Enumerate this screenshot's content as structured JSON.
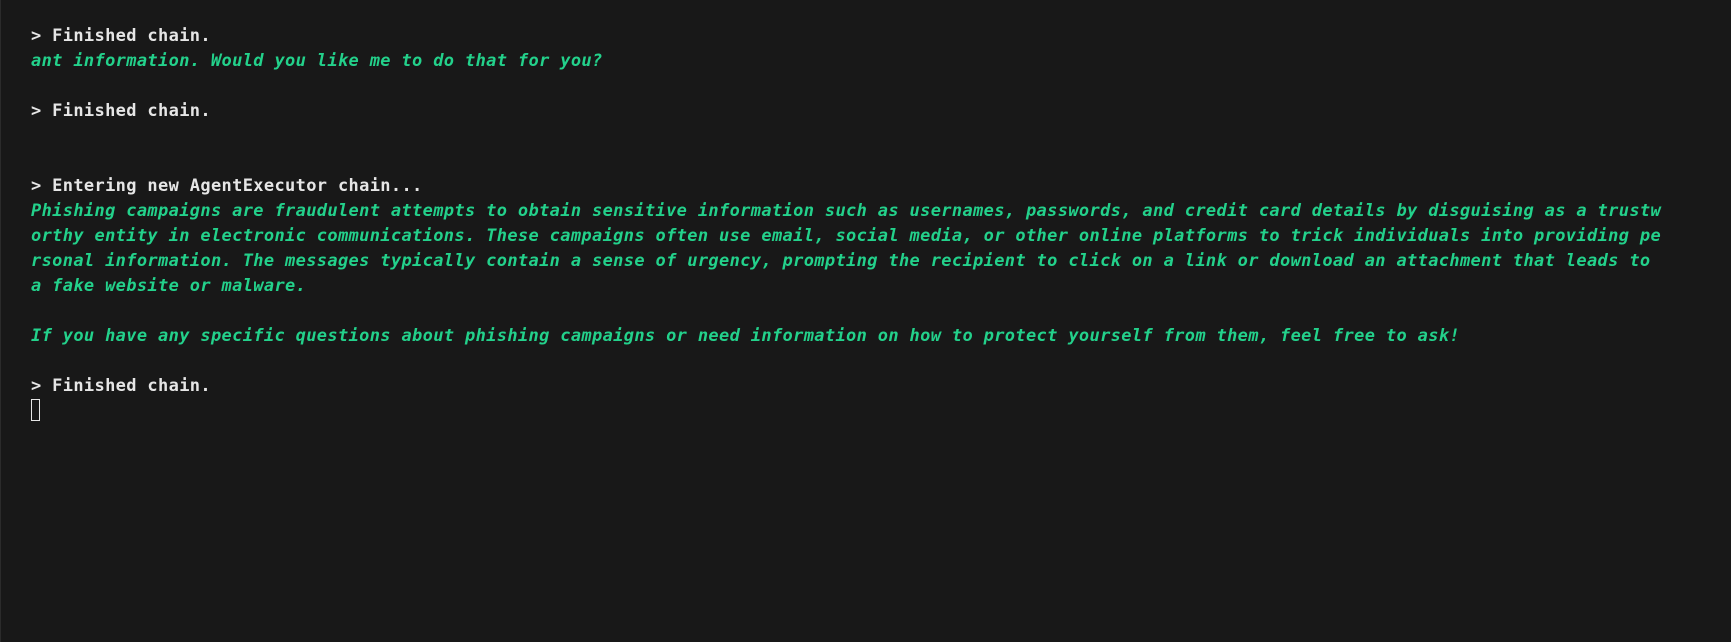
{
  "terminal": {
    "colors": {
      "background": "#181818",
      "status_text": "#e6e6e6",
      "agent_text": "#23d18b"
    },
    "lines": [
      "> Finished chain.",
      "ant information. Would you like me to do that for you?",
      "> Finished chain.",
      "> Entering new AgentExecutor chain...",
      "Phishing campaigns are fraudulent attempts to obtain sensitive information such as usernames, passwords, and credit card details by disguising as a trustw",
      "orthy entity in electronic communications. These campaigns often use email, social media, or other online platforms to trick individuals into providing pe",
      "rsonal information. The messages typically contain a sense of urgency, prompting the recipient to click on a link or download an attachment that leads to",
      "a fake website or malware.",
      "If you have any specific questions about phishing campaigns or need information on how to protect yourself from them, feel free to ask!",
      "> Finished chain."
    ],
    "cursor_icon": "block-cursor-icon"
  }
}
